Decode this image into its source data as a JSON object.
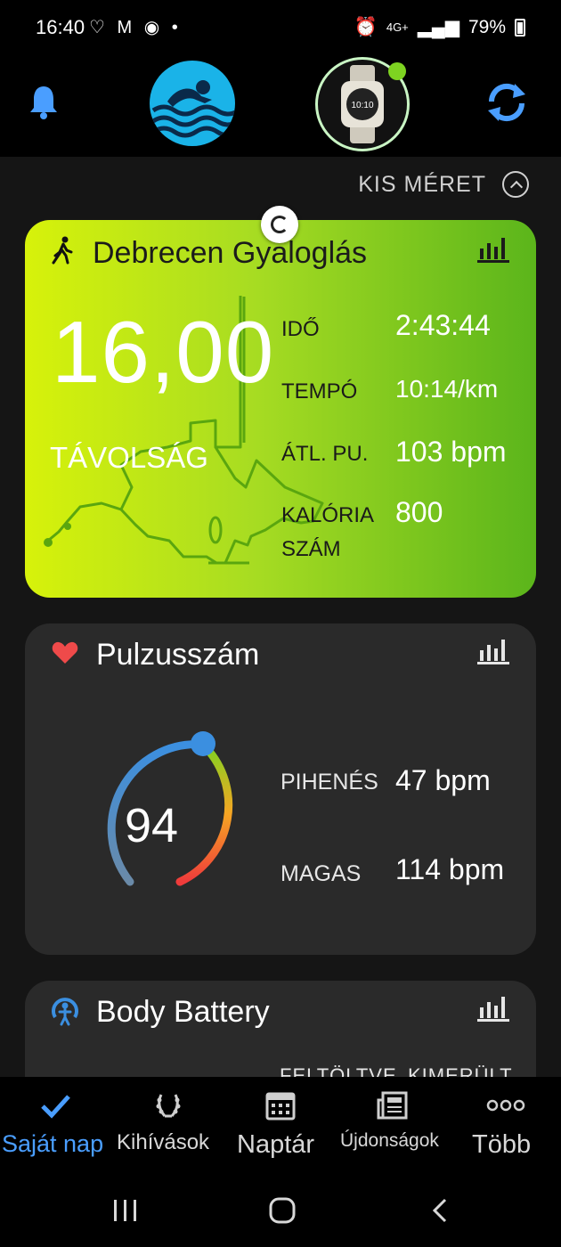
{
  "status_bar": {
    "time": "16:40",
    "left_icons": "♡ M ◉ •",
    "network": "4G+",
    "battery_percent": "79%"
  },
  "top_bar": {
    "bell_icon": "bell-icon",
    "profile_avatar": "swimmer-avatar",
    "device_image": "watch-device",
    "sync_icon": "sync-icon",
    "device_connected_color": "#7ed321"
  },
  "size_toggle": {
    "label": "KIS MÉRET"
  },
  "activity_card": {
    "title": "Debrecen Gyaloglás",
    "distance_value": "16,00",
    "distance_label": "TÁVOLSÁG",
    "stats": [
      {
        "label": "IDŐ",
        "value": "2:43:44"
      },
      {
        "label": "TEMPÓ",
        "value": "10:14/km"
      },
      {
        "label": "ÁTL. PU.",
        "value": "103 bpm"
      },
      {
        "label": "KALÓRIA",
        "label2": "SZÁM",
        "value": "800"
      }
    ]
  },
  "heart_card": {
    "title": "Pulzusszám",
    "current": "94",
    "resting_label": "PIHENÉS",
    "resting_value": "47 bpm",
    "high_label": "MAGAS",
    "high_value": "114 bpm",
    "heart_color": "#ef4a4a"
  },
  "battery_card": {
    "title": "Body Battery",
    "charged_label": "FELTÖLTVE",
    "drained_label": "KIMERÜLT"
  },
  "bottom_nav": {
    "items": [
      {
        "label": "Saját nap",
        "icon": "check-icon",
        "active": true
      },
      {
        "label": "Kihívások",
        "icon": "laurel-icon",
        "active": false
      },
      {
        "label": "Naptár",
        "icon": "calendar-icon",
        "active": false
      },
      {
        "label": "Újdonságok",
        "icon": "newspaper-icon",
        "active": false
      },
      {
        "label": "Több",
        "icon": "more-dots-icon",
        "active": false
      }
    ],
    "active_color": "#4a9eff"
  }
}
